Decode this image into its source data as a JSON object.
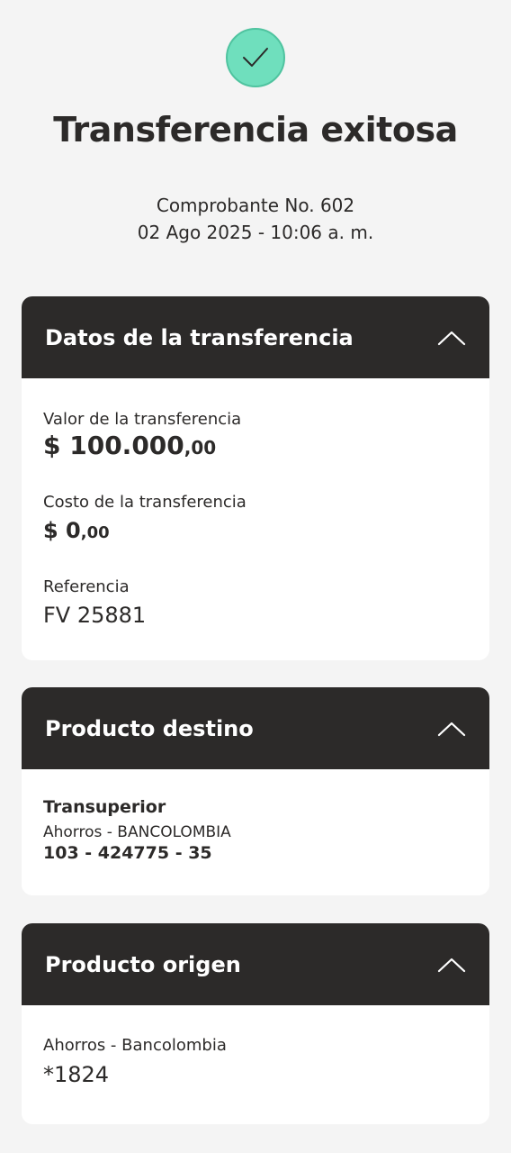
{
  "header": {
    "title": "Transferencia exitosa",
    "receipt_number": "Comprobante No. 602",
    "datetime": "02 Ago 2025 - 10:06 a. m.",
    "status_icon": "check-icon",
    "status_color": "#6fdfbd"
  },
  "transfer_details": {
    "title": "Datos de la transferencia",
    "value_label": "Valor de la transferencia",
    "value_main": "$ 100.000",
    "value_cents": ",00",
    "cost_label": "Costo de la transferencia",
    "cost_main": "$ 0",
    "cost_cents": ",00",
    "reference_label": "Referencia",
    "reference_value": "FV 25881"
  },
  "destination": {
    "title": "Producto destino",
    "name": "Transuperior",
    "account_type": "Ahorros - BANCOLOMBIA",
    "account_number": "103 - 424775 - 35"
  },
  "origin": {
    "title": "Producto origen",
    "account_type": "Ahorros - Bancolombia",
    "account_number": "*1824"
  },
  "colors": {
    "header_bg": "#2c2a29",
    "page_bg": "#f4f4f4",
    "card_bg": "#ffffff"
  }
}
